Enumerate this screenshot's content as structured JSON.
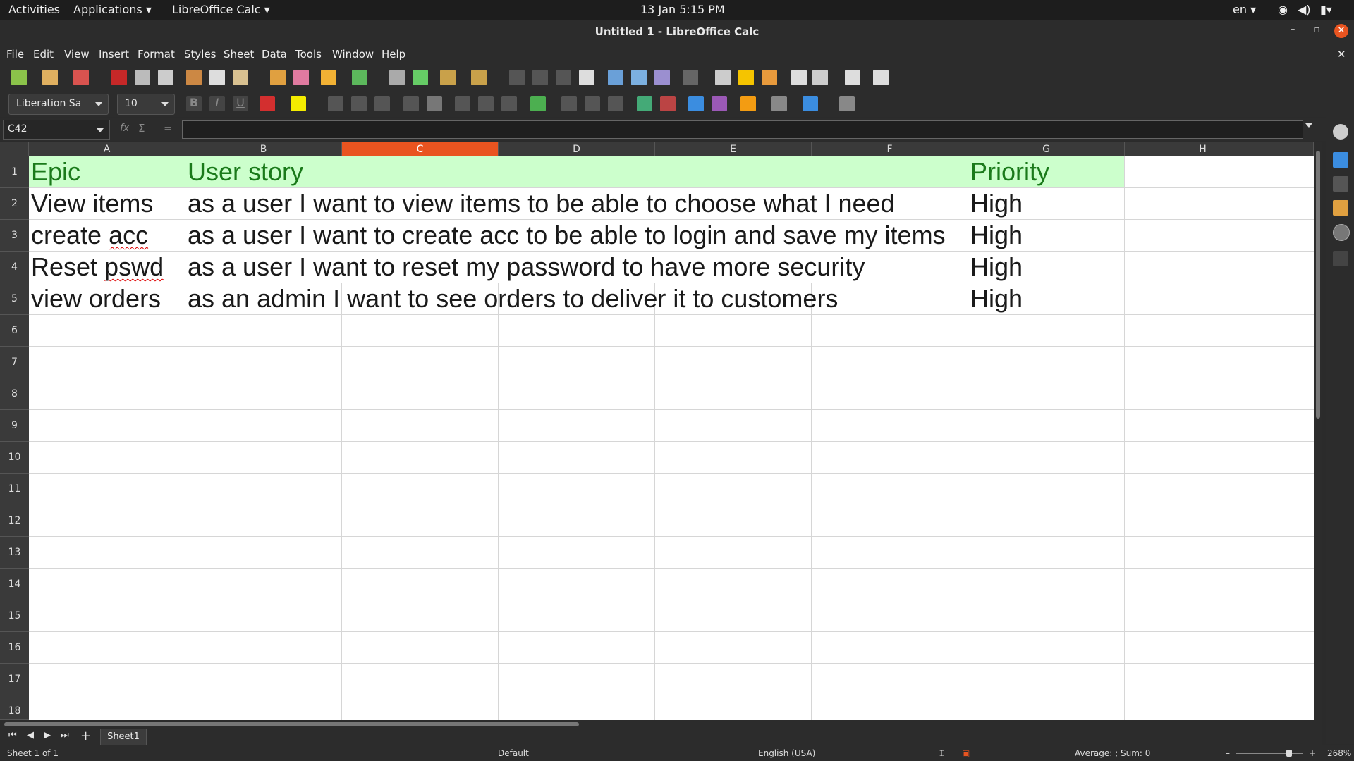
{
  "topbar": {
    "activities": "Activities",
    "applications": "Applications ▾",
    "app": "LibreOffice Calc ▾",
    "clock": "13 Jan  5:15 PM",
    "lang": "en ▾"
  },
  "window": {
    "title": "Untitled 1 - LibreOffice Calc"
  },
  "menu": [
    "File",
    "Edit",
    "View",
    "Insert",
    "Format",
    "Styles",
    "Sheet",
    "Data",
    "Tools",
    "Window",
    "Help"
  ],
  "toolbar": {
    "font_name": "Liberation Sa",
    "font_size": "10"
  },
  "formula": {
    "cell_ref": "C42",
    "content": ""
  },
  "columns": [
    "A",
    "B",
    "C",
    "D",
    "E",
    "F",
    "G",
    "H"
  ],
  "selected_column": "C",
  "rows": [
    "1",
    "2",
    "3",
    "4",
    "5",
    "6",
    "7",
    "8",
    "9",
    "10",
    "11",
    "12",
    "13",
    "14",
    "15",
    "16",
    "17",
    "18"
  ],
  "cells": {
    "A1": "Epic",
    "B1": "User story",
    "G1": "Priority",
    "A2": "View items",
    "B2": "as a user I want to view items to be able to choose what I need",
    "G2": "High",
    "A3": "create acc",
    "B3": "as a user I want to create acc to be able to login and save my items",
    "G3": "High",
    "A4": "Reset pswd",
    "B4": "as a user I want to reset my password to have more security",
    "G4": "High",
    "A5": "view orders",
    "B5": "as an admin I want to see orders to deliver it to customers",
    "G5": "High"
  },
  "sheets": [
    "Sheet1"
  ],
  "status": {
    "sheet": "Sheet 1 of 1",
    "style": "Default",
    "language": "English (USA)",
    "summary": "Average: ; Sum: 0",
    "zoom": "268%"
  },
  "colors": {
    "accent": "#e95420",
    "header_fill": "#ccffcc",
    "header_text": "#1a7a1a"
  }
}
